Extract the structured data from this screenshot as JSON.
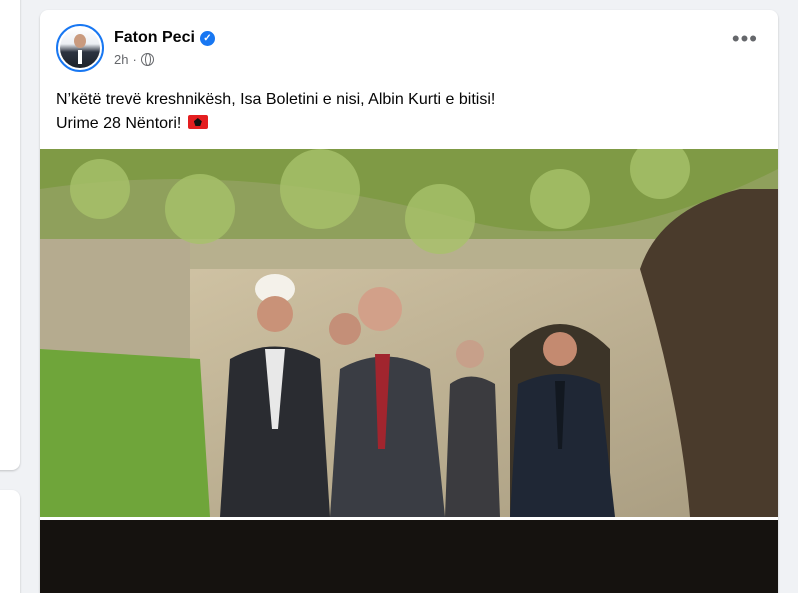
{
  "post": {
    "author": "Faton Peci",
    "time": "2h",
    "text_line1": "N’këtë trevë kreshnikësh, Isa Boletini e nisi, Albin Kurti e bitisi!",
    "text_line2": "Urime 28 Nëntori!",
    "icons": [
      "verified-badge",
      "globe-icon",
      "more-options-icon",
      "albanian-flag-emoji"
    ]
  },
  "colors": {
    "accent": "#1877f2",
    "background": "#f0f2f5",
    "text": "#050505",
    "secondary_text": "#65676b"
  }
}
